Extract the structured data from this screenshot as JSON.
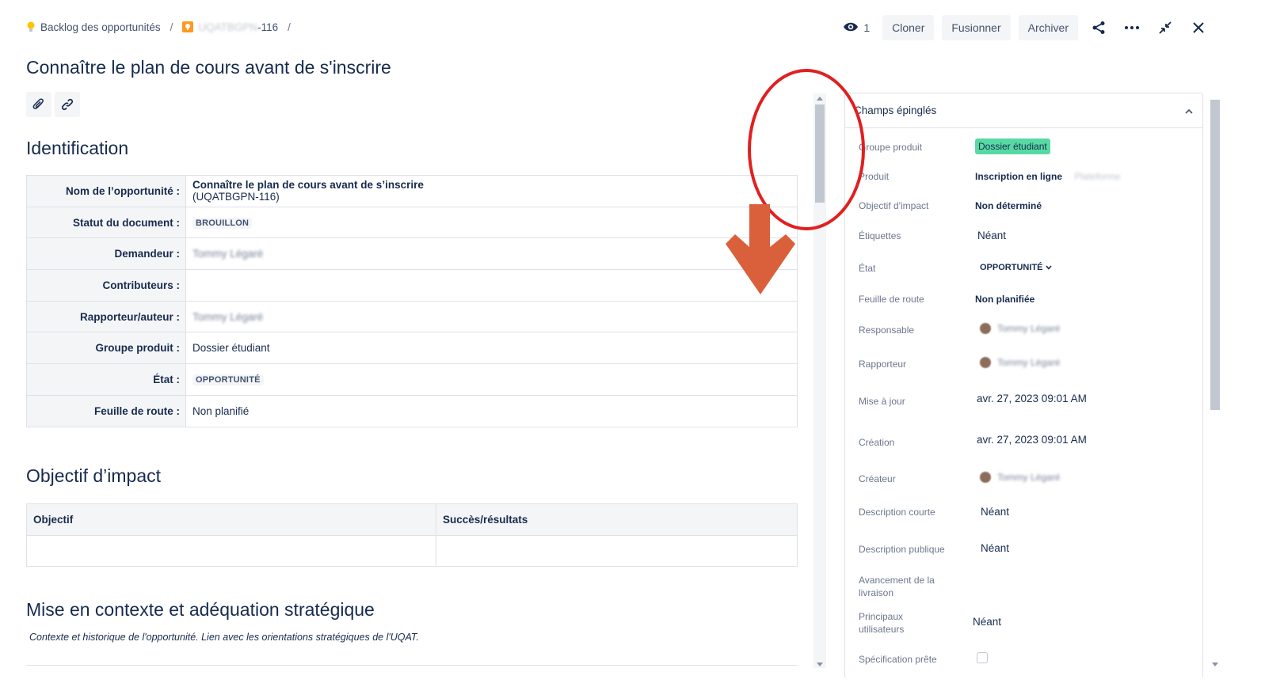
{
  "breadcrumb": {
    "project": "Backlog des opportunités",
    "issue_key_hidden": "UQATBGPN",
    "issue_key_suffix": "-116",
    "separator": "/"
  },
  "header": {
    "watch_count": "1",
    "clone_label": "Cloner",
    "merge_label": "Fusionner",
    "archive_label": "Archiver"
  },
  "issue": {
    "title": "Connaître le plan de cours avant de s'inscrire"
  },
  "identification": {
    "heading": "Identification",
    "rows": [
      {
        "label": "Nom de l’opportunité :",
        "value": "Connaître le plan de cours avant de s’inscrire",
        "value2": "(UQATBGPN-116)"
      },
      {
        "label": "Statut du document :",
        "value": "BROUILLON"
      },
      {
        "label": "Demandeur :",
        "value": "Tommy Légaré"
      },
      {
        "label": "Contributeurs :",
        "value": ""
      },
      {
        "label": "Rapporteur/auteur :",
        "value": "Tommy Légaré"
      },
      {
        "label": "Groupe produit :",
        "value": "Dossier étudiant"
      },
      {
        "label": "État :",
        "value": "OPPORTUNITÉ"
      },
      {
        "label": "Feuille de route :",
        "value": "Non planifié"
      }
    ]
  },
  "objectif": {
    "heading": "Objectif d’impact",
    "col1": "Objectif",
    "col2": "Succès/résultats"
  },
  "contexte": {
    "heading": "Mise en contexte et adéquation stratégique",
    "description": "Contexte et historique de l'opportunité. Lien avec les orientations stratégiques de l'UQAT."
  },
  "side": {
    "heading": "Champs épinglés",
    "fields": {
      "groupe_produit": {
        "label": "Groupe produit",
        "value": "Dossier étudiant"
      },
      "produit": {
        "label": "Produit",
        "value": "Inscription en ligne",
        "extra": "Plateforme"
      },
      "objectif": {
        "label": "Objectif d'impact",
        "value": "Non déterminé"
      },
      "etiquettes": {
        "label": "Étiquettes",
        "value": "Néant"
      },
      "etat": {
        "label": "État",
        "value": "OPPORTUNITÉ"
      },
      "feuille": {
        "label": "Feuille de route",
        "value": "Non planifiée"
      },
      "responsable": {
        "label": "Responsable",
        "value": "Tommy Légaré"
      },
      "rapporteur": {
        "label": "Rapporteur",
        "value": "Tommy Légaré"
      },
      "maj": {
        "label": "Mise à jour",
        "value": "avr. 27, 2023 09:01 AM"
      },
      "creation": {
        "label": "Création",
        "value": "avr. 27, 2023 09:01 AM"
      },
      "createur": {
        "label": "Créateur",
        "value": "Tommy Légaré"
      },
      "desc_courte": {
        "label": "Description courte",
        "value": "Néant"
      },
      "desc_publique": {
        "label": "Description publique",
        "value": "Néant"
      },
      "avancement": {
        "label": "Avancement de la livraison"
      },
      "utilisateurs": {
        "label": "Principaux utilisateurs",
        "value": "Néant"
      },
      "spec": {
        "label": "Spécification prête"
      }
    }
  },
  "colors": {
    "accent_green": "#57d9a3",
    "annotation_red": "#e02020",
    "annotation_arrow": "#d9603b"
  }
}
